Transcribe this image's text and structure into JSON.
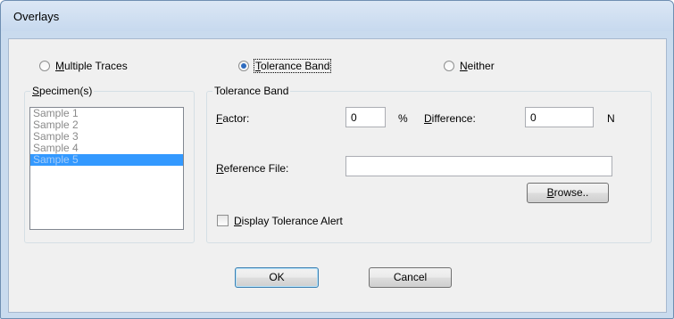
{
  "window": {
    "title": "Overlays"
  },
  "radios": {
    "multiple_traces": {
      "pre": "",
      "u": "M",
      "post": "ultiple Traces",
      "selected": false
    },
    "tolerance_band": {
      "pre": "",
      "u": "T",
      "post": "olerance Band",
      "selected": true
    },
    "neither": {
      "pre": "",
      "u": "N",
      "post": "either",
      "selected": false
    }
  },
  "specimens": {
    "title_u": "S",
    "title_post": "pecimen(s)",
    "items": [
      "Sample 1",
      "Sample 2",
      "Sample 3",
      "Sample 4",
      "Sample 5"
    ],
    "selected_index": 4
  },
  "tolerance_band": {
    "title": "Tolerance Band",
    "factor": {
      "u": "F",
      "post": "actor:",
      "value": "0",
      "unit": "%"
    },
    "difference": {
      "u": "D",
      "post": "ifference:",
      "value": "0",
      "unit": "N"
    },
    "reference_file": {
      "u": "R",
      "post": "eference File:",
      "value": ""
    },
    "browse": {
      "u": "B",
      "post": "rowse.."
    },
    "display_alert": {
      "pre": "",
      "u": "D",
      "post": "isplay Tolerance Alert",
      "checked": false
    }
  },
  "buttons": {
    "ok": "OK",
    "cancel": "Cancel"
  },
  "colors": {
    "selection": "#3399ff",
    "radio_dot": "#2d6bbf",
    "title_bar": "#c9dbee"
  }
}
